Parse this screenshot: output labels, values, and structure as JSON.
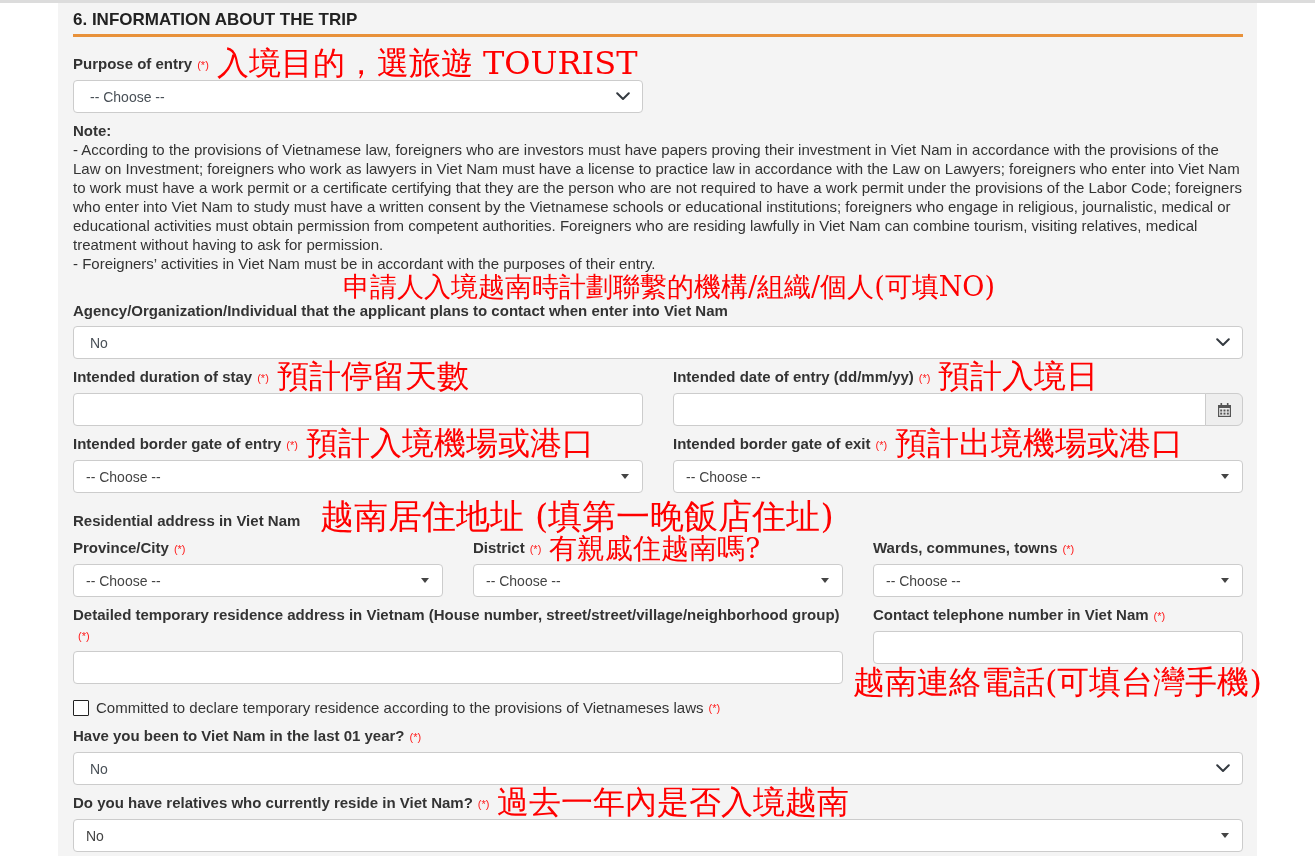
{
  "section_title": "6. INFORMATION ABOUT THE TRIP",
  "blocks": [
    {
      "kind": "fields",
      "fields": [
        {
          "label": "Purpose of entry",
          "required_mark": "(*)",
          "annotation": {
            "kind": "label",
            "text": "入境目的，選旅遊 TOURIST"
          },
          "control": {
            "kind": "select",
            "value": "-- Choose --"
          }
        }
      ]
    },
    {
      "kind": "note",
      "title": "Note:",
      "paragraphs": [
        "- According to the provisions of Vietnamese law, foreigners who are investors must have papers proving their investment in Viet Nam in accordance with the provisions of the Law on Investment; foreigners who work as lawyers in Viet Nam must have a license to practice law in accordance with the Law on Lawyers; foreigners who enter into Viet Nam to work must have a work permit or a certificate certifying that they are the person who are not required to have a work permit under the provisions of the Labor Code; foreigners who enter into Viet Nam to study must have a written consent by the Vietnamese schools or educational institutions; foreigners who engage in religious, journalistic, medical or educational activities must obtain permission from competent authorities. Foreigners who are residing lawfully in Viet Nam can combine tourism, visiting relatives, medical treatment without having to ask for permission.",
        "- Foreigners’ activities in Viet Nam must be in accordant with the purposes of their entry."
      ]
    },
    {
      "kind": "annotation",
      "text": "申請人入境越南時計劃聯繫的機構/組織/個人(可填NO)"
    },
    {
      "kind": "fields",
      "fields": [
        {
          "label": "Agency/Organization/Individual that the applicant plans to contact when enter into Viet Nam",
          "control": {
            "kind": "select",
            "value": "No"
          }
        }
      ]
    },
    {
      "kind": "fields",
      "fields": [
        {
          "label": "Intended duration of stay",
          "required_mark": "(*)",
          "annotation": {
            "kind": "label",
            "text": "預計停留天數"
          },
          "control": {
            "kind": "text"
          }
        },
        {
          "label": "Intended date of entry (dd/mm/yy)",
          "required_mark": "(*)",
          "annotation": {
            "kind": "label",
            "text": "預計入境日"
          },
          "control": {
            "kind": "date"
          }
        }
      ]
    },
    {
      "kind": "fields",
      "fields": [
        {
          "label": "Intended border gate of entry",
          "required_mark": "(*)",
          "annotation": {
            "kind": "label",
            "text": "預計入境機場或港口"
          },
          "control": {
            "kind": "combo",
            "value": "-- Choose --"
          }
        },
        {
          "label": "Intended border gate of exit",
          "required_mark": "(*)",
          "annotation": {
            "kind": "label",
            "text": "預計出境機場或港口"
          },
          "control": {
            "kind": "combo",
            "value": "-- Choose --"
          }
        }
      ]
    },
    {
      "kind": "heading",
      "text": "Residential address in Viet Nam",
      "annotation": {
        "kind": "label",
        "text": "越南居住地址 (填第一晚飯店住址)"
      }
    },
    {
      "kind": "fields",
      "fields": [
        {
          "label": "Province/City",
          "required_mark": "(*)",
          "control": {
            "kind": "combo",
            "value": "-- Choose --"
          }
        },
        {
          "label": "District",
          "required_mark": "(*)",
          "annotation": {
            "kind": "label",
            "text": "有親戚住越南嗎?"
          },
          "control": {
            "kind": "combo",
            "value": "-- Choose --"
          }
        },
        {
          "label": "Wards, communes, towns",
          "required_mark": "(*)",
          "control": {
            "kind": "combo",
            "value": "-- Choose --"
          }
        }
      ]
    },
    {
      "kind": "fields",
      "fields": [
        {
          "label": "Detailed temporary residence address in Vietnam (House number, street/street/village/neighborhood group)",
          "required_mark": "(*)",
          "control": {
            "kind": "text"
          }
        },
        {
          "label": "Contact telephone number in Viet Nam",
          "required_mark": "(*)",
          "annotation": {
            "kind": "below",
            "text": "越南連絡電話(可填台灣手機)"
          },
          "control": {
            "kind": "text"
          }
        }
      ]
    },
    {
      "kind": "checkbox",
      "label": "Committed to declare temporary residence according to the provisions of Vietnameses laws",
      "required_mark": "(*)",
      "checked": false
    },
    {
      "kind": "fields",
      "fields": [
        {
          "label": "Have you been to Viet Nam in the last 01 year?",
          "required_mark": "(*)",
          "control": {
            "kind": "select",
            "value": "No"
          }
        }
      ]
    },
    {
      "kind": "fields",
      "fields": [
        {
          "label": "Do you have relatives who currently reside in Viet Nam?",
          "required_mark": "(*)",
          "annotation": {
            "kind": "label",
            "text": "過去一年內是否入境越南"
          },
          "control": {
            "kind": "combo",
            "value": "No"
          }
        }
      ]
    }
  ]
}
